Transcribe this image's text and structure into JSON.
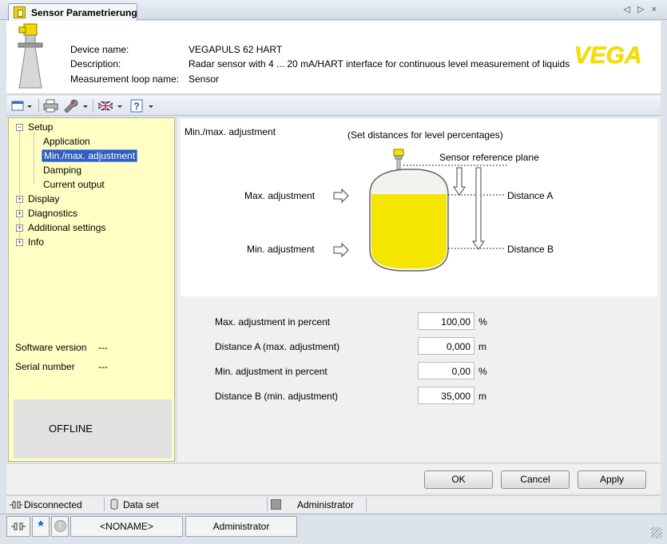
{
  "tab": {
    "title": "Sensor Parametrierung",
    "nav_arrows": "◁ ▷ ×"
  },
  "header": {
    "device_name_label": "Device name:",
    "device_name_value": "VEGAPULS 62 HART",
    "description_label": "Description:",
    "description_value": "Radar sensor with 4 ... 20 mA/HART interface for continuous level measurement of liquids",
    "loop_label": "Measurement loop name:",
    "loop_value": "Sensor",
    "logo_text": "VEGA"
  },
  "tree": {
    "setup": "Setup",
    "application": "Application",
    "minmax": "Min./max. adjustment",
    "damping": "Damping",
    "current_output": "Current output",
    "display": "Display",
    "diagnostics": "Diagnostics",
    "additional_settings": "Additional settings",
    "info": "Info"
  },
  "left_info": {
    "software_label": "Software version",
    "software_value": "---",
    "serial_label": "Serial number",
    "serial_value": "---",
    "status": "OFFLINE"
  },
  "diagram": {
    "title": "Min./max. adjustment",
    "hint": "(Set distances for level percentages)",
    "sensor_ref": "Sensor reference plane",
    "max_adj": "Max. adjustment",
    "min_adj": "Min. adjustment",
    "dist_a": "Distance A",
    "dist_b": "Distance B"
  },
  "fields": [
    {
      "label": "Max. adjustment in percent",
      "value": "100,00",
      "unit": "%"
    },
    {
      "label": "Distance A (max. adjustment)",
      "value": "0,000",
      "unit": "m"
    },
    {
      "label": "Min. adjustment in percent",
      "value": "0,00",
      "unit": "%"
    },
    {
      "label": "Distance B (min. adjustment)",
      "value": "35,000",
      "unit": "m"
    }
  ],
  "buttons": {
    "ok": "OK",
    "cancel": "Cancel",
    "apply": "Apply"
  },
  "status": {
    "connection": "Disconnected",
    "dataset": "Data set",
    "user": "Administrator"
  },
  "footer": {
    "project": "<NONAME>",
    "user": "Administrator"
  },
  "colors": {
    "accent_yellow": "#f5e100",
    "tree_bg": "#ffffc4",
    "selection": "#2f5fbf"
  }
}
